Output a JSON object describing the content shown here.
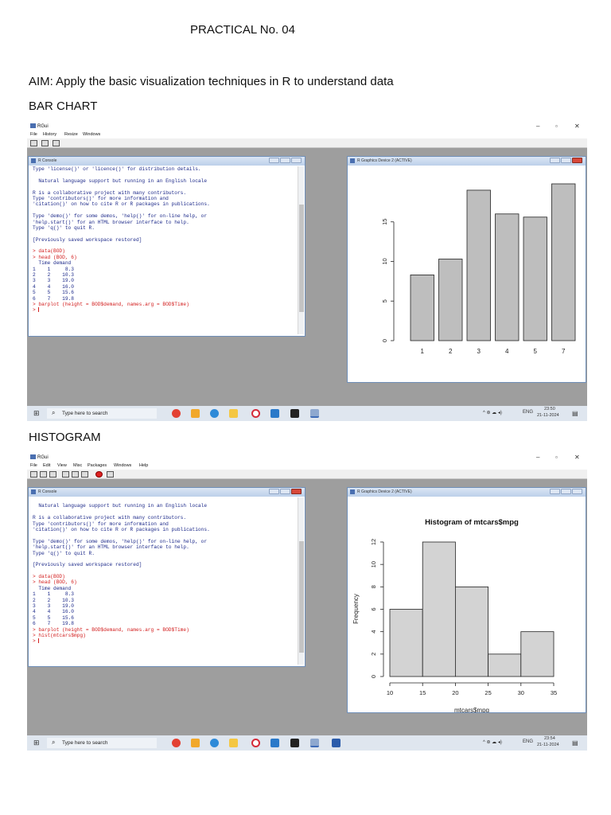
{
  "document": {
    "title": "PRACTICAL No. 04",
    "aim": "AIM: Apply the basic visualization techniques in R to understand data",
    "section1": "BAR CHART",
    "section2": "HISTOGRAM"
  },
  "screenshot1": {
    "app_title": "RGui",
    "menu": [
      "File",
      "History",
      "Resize",
      "Windows"
    ],
    "window_controls": [
      "–",
      "▫",
      "✕"
    ],
    "console_title": "R Console",
    "console_lines": [
      {
        "text": "Type 'license()' or 'licence()' for distribution details.",
        "color": "blue"
      },
      {
        "text": "",
        "color": "blue"
      },
      {
        "text": "  Natural language support but running in an English locale",
        "color": "blue"
      },
      {
        "text": "",
        "color": "blue"
      },
      {
        "text": "R is a collaborative project with many contributors.",
        "color": "blue"
      },
      {
        "text": "Type 'contributors()' for more information and",
        "color": "blue"
      },
      {
        "text": "'citation()' on how to cite R or R packages in publications.",
        "color": "blue"
      },
      {
        "text": "",
        "color": "blue"
      },
      {
        "text": "Type 'demo()' for some demos, 'help()' for on-line help, or",
        "color": "blue"
      },
      {
        "text": "'help.start()' for an HTML browser interface to help.",
        "color": "blue"
      },
      {
        "text": "Type 'q()' to quit R.",
        "color": "blue"
      },
      {
        "text": "",
        "color": "blue"
      },
      {
        "text": "[Previously saved workspace restored]",
        "color": "blue"
      },
      {
        "text": "",
        "color": "blue"
      },
      {
        "text": "> data(BOD)",
        "color": "red"
      },
      {
        "text": "> head (BOD, 6)",
        "color": "red"
      },
      {
        "text": "  Time demand",
        "color": "blue"
      },
      {
        "text": "1    1     8.3",
        "color": "blue"
      },
      {
        "text": "2    2    10.3",
        "color": "blue"
      },
      {
        "text": "3    3    19.0",
        "color": "blue"
      },
      {
        "text": "4    4    16.0",
        "color": "blue"
      },
      {
        "text": "5    5    15.6",
        "color": "blue"
      },
      {
        "text": "6    7    19.8",
        "color": "blue"
      },
      {
        "text": "> barplot (height = BOD$demand, names.arg = BOD$Time)",
        "color": "red"
      },
      {
        "text": "> ",
        "color": "red",
        "cursor": true
      }
    ],
    "graphics_title": "R Graphics Device 2 (ACTIVE)",
    "taskbar_search": "Type here to search",
    "tray_lang": "ENG",
    "tray_time": "23:50",
    "tray_date": "21-11-2024"
  },
  "screenshot2": {
    "app_title": "RGui",
    "menu": [
      "File",
      "Edit",
      "View",
      "Misc",
      "Packages",
      "Windows",
      "Help"
    ],
    "window_controls": [
      "–",
      "▫",
      "✕"
    ],
    "console_title": "R Console",
    "console_lines": [
      {
        "text": "",
        "color": "blue"
      },
      {
        "text": "  Natural language support but running in an English locale",
        "color": "blue"
      },
      {
        "text": "",
        "color": "blue"
      },
      {
        "text": "R is a collaborative project with many contributors.",
        "color": "blue"
      },
      {
        "text": "Type 'contributors()' for more information and",
        "color": "blue"
      },
      {
        "text": "'citation()' on how to cite R or R packages in publications.",
        "color": "blue"
      },
      {
        "text": "",
        "color": "blue"
      },
      {
        "text": "Type 'demo()' for some demos, 'help()' for on-line help, or",
        "color": "blue"
      },
      {
        "text": "'help.start()' for an HTML browser interface to help.",
        "color": "blue"
      },
      {
        "text": "Type 'q()' to quit R.",
        "color": "blue"
      },
      {
        "text": "",
        "color": "blue"
      },
      {
        "text": "[Previously saved workspace restored]",
        "color": "blue"
      },
      {
        "text": "",
        "color": "blue"
      },
      {
        "text": "> data(BOD)",
        "color": "red"
      },
      {
        "text": "> head (BOD, 6)",
        "color": "red"
      },
      {
        "text": "  Time demand",
        "color": "blue"
      },
      {
        "text": "1    1     8.3",
        "color": "blue"
      },
      {
        "text": "2    2    10.3",
        "color": "blue"
      },
      {
        "text": "3    3    19.0",
        "color": "blue"
      },
      {
        "text": "4    4    16.0",
        "color": "blue"
      },
      {
        "text": "5    5    15.6",
        "color": "blue"
      },
      {
        "text": "6    7    19.8",
        "color": "blue"
      },
      {
        "text": "> barplot (height = BOD$demand, names.arg = BOD$Time)",
        "color": "red"
      },
      {
        "text": "> hist(mtcars$mpg)",
        "color": "red"
      },
      {
        "text": "> ",
        "color": "red",
        "cursor": true
      }
    ],
    "graphics_title": "R Graphics Device 2 (ACTIVE)",
    "taskbar_search": "Type here to search",
    "tray_lang": "ENG",
    "tray_time": "23:54",
    "tray_date": "21-11-2024"
  },
  "chart_data": [
    {
      "type": "bar",
      "title": "",
      "categories": [
        "1",
        "2",
        "3",
        "4",
        "5",
        "7"
      ],
      "values": [
        8.3,
        10.3,
        19.0,
        16.0,
        15.6,
        19.8
      ],
      "yticks": [
        0,
        5,
        10,
        15
      ],
      "ylim": [
        0,
        20
      ],
      "xlabel": "",
      "ylabel": "",
      "bar_color": "#bebebe",
      "grid": false
    },
    {
      "type": "bar",
      "title": "Histogram of mtcars$mpg",
      "bins": [
        [
          10,
          15
        ],
        [
          15,
          20
        ],
        [
          20,
          25
        ],
        [
          25,
          30
        ],
        [
          30,
          35
        ]
      ],
      "values": [
        6,
        12,
        8,
        2,
        4
      ],
      "xticks": [
        10,
        15,
        20,
        25,
        30,
        35
      ],
      "yticks": [
        0,
        2,
        4,
        6,
        8,
        10,
        12
      ],
      "xlim": [
        10,
        35
      ],
      "ylim": [
        0,
        12
      ],
      "xlabel": "mtcars$mpg",
      "ylabel": "Frequency",
      "bar_color": "#d3d3d3",
      "grid": false
    }
  ]
}
